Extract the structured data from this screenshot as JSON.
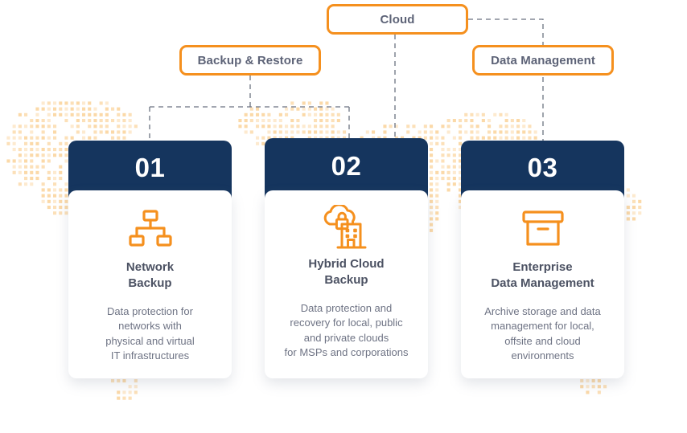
{
  "theme": {
    "accent_orange": "#f5901e",
    "navy": "#15355e",
    "text_gray": "#5d6377",
    "desc_gray": "#6e7384",
    "map_dot": "#fbd9a8",
    "connector_gray": "#6b7280",
    "page_background": "#ffffff"
  },
  "top_nodes": [
    {
      "id": "cloud",
      "label": "Cloud"
    },
    {
      "id": "backup-restore",
      "label": "Backup & Restore"
    },
    {
      "id": "data-management",
      "label": "Data Management"
    }
  ],
  "cards": [
    {
      "number": "01",
      "icon": "network-hierarchy-icon",
      "title": "Network\nBackup",
      "description": "Data protection for\nnetworks with\nphysical and virtual\nIT infrastructures"
    },
    {
      "number": "02",
      "icon": "cloud-lock-building-icon",
      "title": "Hybrid Cloud\nBackup",
      "description": "Data protection and\nrecovery for local, public\nand private clouds\nfor MSPs and corporations"
    },
    {
      "number": "03",
      "icon": "archive-box-icon",
      "title": "Enterprise\nData Management",
      "description": "Archive storage and data\nmanagement for local,\noffsite and cloud\nenvironments"
    }
  ]
}
